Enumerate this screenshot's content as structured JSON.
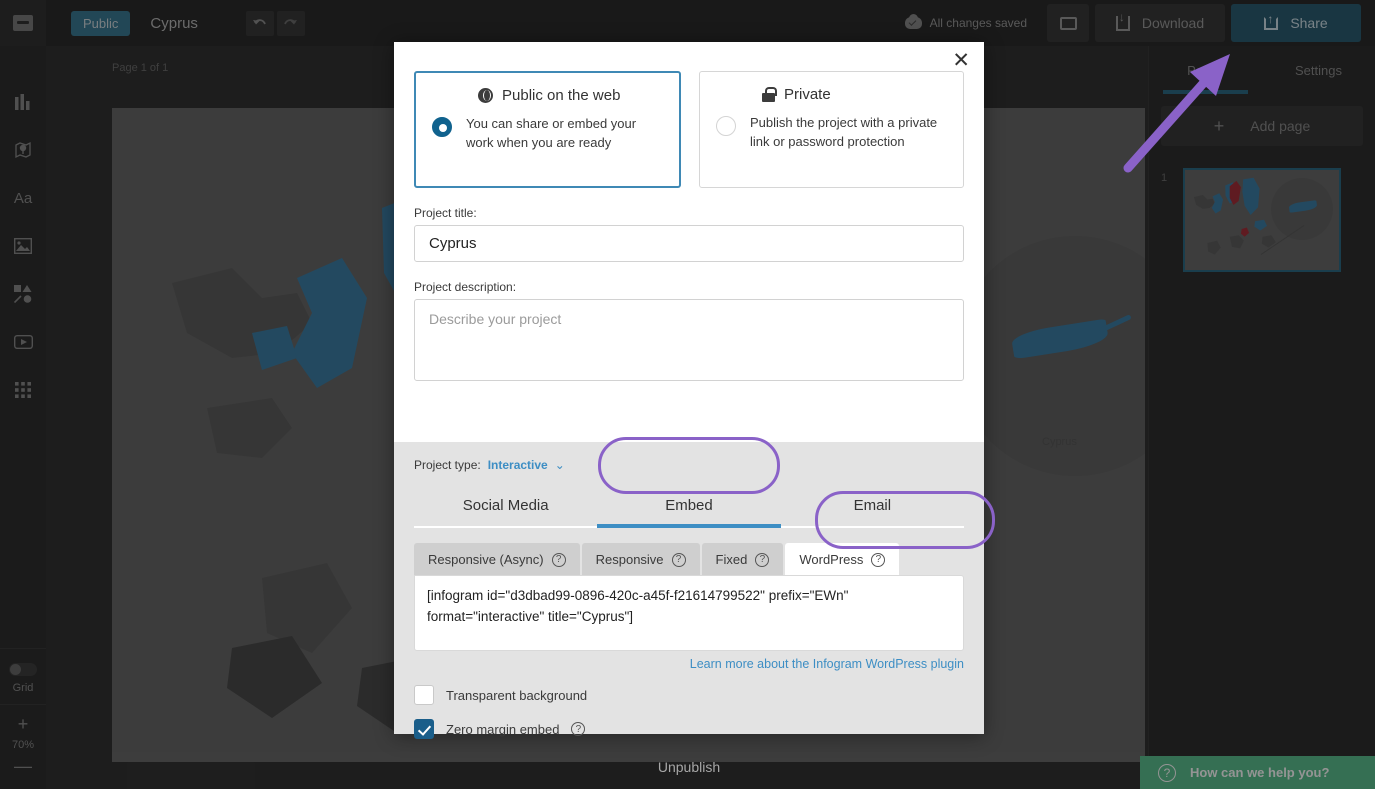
{
  "topbar": {
    "logo_icon": "archive-box-icon",
    "visibility_badge": "Public",
    "document_title": "Cyprus",
    "undo_icon": "undo-arrow-icon",
    "redo_icon": "redo-arrow-icon",
    "save_status": "All changes saved",
    "save_icon": "cloud-check-icon",
    "preview_icon": "monitor-icon",
    "download_label": "Download",
    "download_icon": "download-icon",
    "share_label": "Share",
    "share_icon": "share-upload-icon"
  },
  "leftrail": {
    "items": [
      {
        "name": "chart-icon",
        "glyph": "▮▮▮"
      },
      {
        "name": "map-pin-icon",
        "glyph": "◉"
      },
      {
        "name": "text-icon",
        "glyph": "Aa"
      },
      {
        "name": "image-icon",
        "glyph": "▣"
      },
      {
        "name": "shapes-icon",
        "glyph": "◤"
      },
      {
        "name": "video-icon",
        "glyph": "▶"
      },
      {
        "name": "apps-grid-icon",
        "glyph": "⠿"
      }
    ],
    "grid_label": "Grid",
    "grid_enabled": false,
    "zoom_in": "+",
    "zoom_level": "70%",
    "zoom_out": "—"
  },
  "canvas": {
    "page_label": "Page 1 of 1",
    "inset_label": "Cyprus"
  },
  "rightpanel": {
    "tabs": [
      {
        "label": "Pages",
        "active": true
      },
      {
        "label": "Settings",
        "active": false
      }
    ],
    "add_page_label": "Add page",
    "add_page_icon": "plus-icon",
    "page_number": "1"
  },
  "help": {
    "icon": "question-circle-icon",
    "label": "How can we help you?"
  },
  "modal": {
    "close_icon": "close-x-icon",
    "visibility_options": [
      {
        "title": "Public on the web",
        "icon": "globe-icon",
        "description": "You can share or embed your work when you are ready",
        "selected": true
      },
      {
        "title": "Private",
        "icon": "lock-icon",
        "description": "Publish the project with a private link or password protection",
        "selected": false
      }
    ],
    "title_label": "Project title:",
    "title_value": "Cyprus",
    "description_label": "Project description:",
    "description_value": "",
    "description_placeholder": "Describe your project",
    "project_type_label": "Project type:",
    "project_type_value": "Interactive",
    "project_type_chevron": "chevron-down-icon",
    "main_tabs": [
      {
        "label": "Social Media",
        "active": false
      },
      {
        "label": "Embed",
        "active": true
      },
      {
        "label": "Email",
        "active": false
      }
    ],
    "sub_tabs": [
      {
        "label": "Responsive (Async)",
        "help": "?",
        "active": false
      },
      {
        "label": "Responsive",
        "help": "?",
        "active": false
      },
      {
        "label": "Fixed",
        "help": "?",
        "active": false
      },
      {
        "label": "WordPress",
        "help": "?",
        "active": true
      }
    ],
    "embed_code": "[infogram id=\"d3dbad99-0896-420c-a45f-f21614799522\" prefix=\"EWn\" format=\"interactive\" title=\"Cyprus\"]",
    "learn_link": "Learn more about the Infogram WordPress plugin",
    "checkboxes": [
      {
        "label": "Transparent background",
        "checked": false,
        "help": false
      },
      {
        "label": "Zero margin embed",
        "checked": true,
        "help": true
      }
    ],
    "unpublish_label": "Unpublish"
  },
  "annotations": {
    "arrow_color": "#8a62c8",
    "ellipse_color": "#8a62c8",
    "arrow_target": "share-button",
    "ellipse_targets": [
      "embed-tab",
      "wordpress-subtab"
    ]
  },
  "colors": {
    "accent_blue": "#3d8ec4",
    "share_blue": "#2c5e72",
    "radio_blue": "#10628e",
    "checkbox_blue": "#1a5e8a",
    "help_green": "#5cbf8f",
    "annotation_purple": "#8a62c8",
    "map_blue": "#3d7fa6",
    "map_red": "#a4303a"
  }
}
